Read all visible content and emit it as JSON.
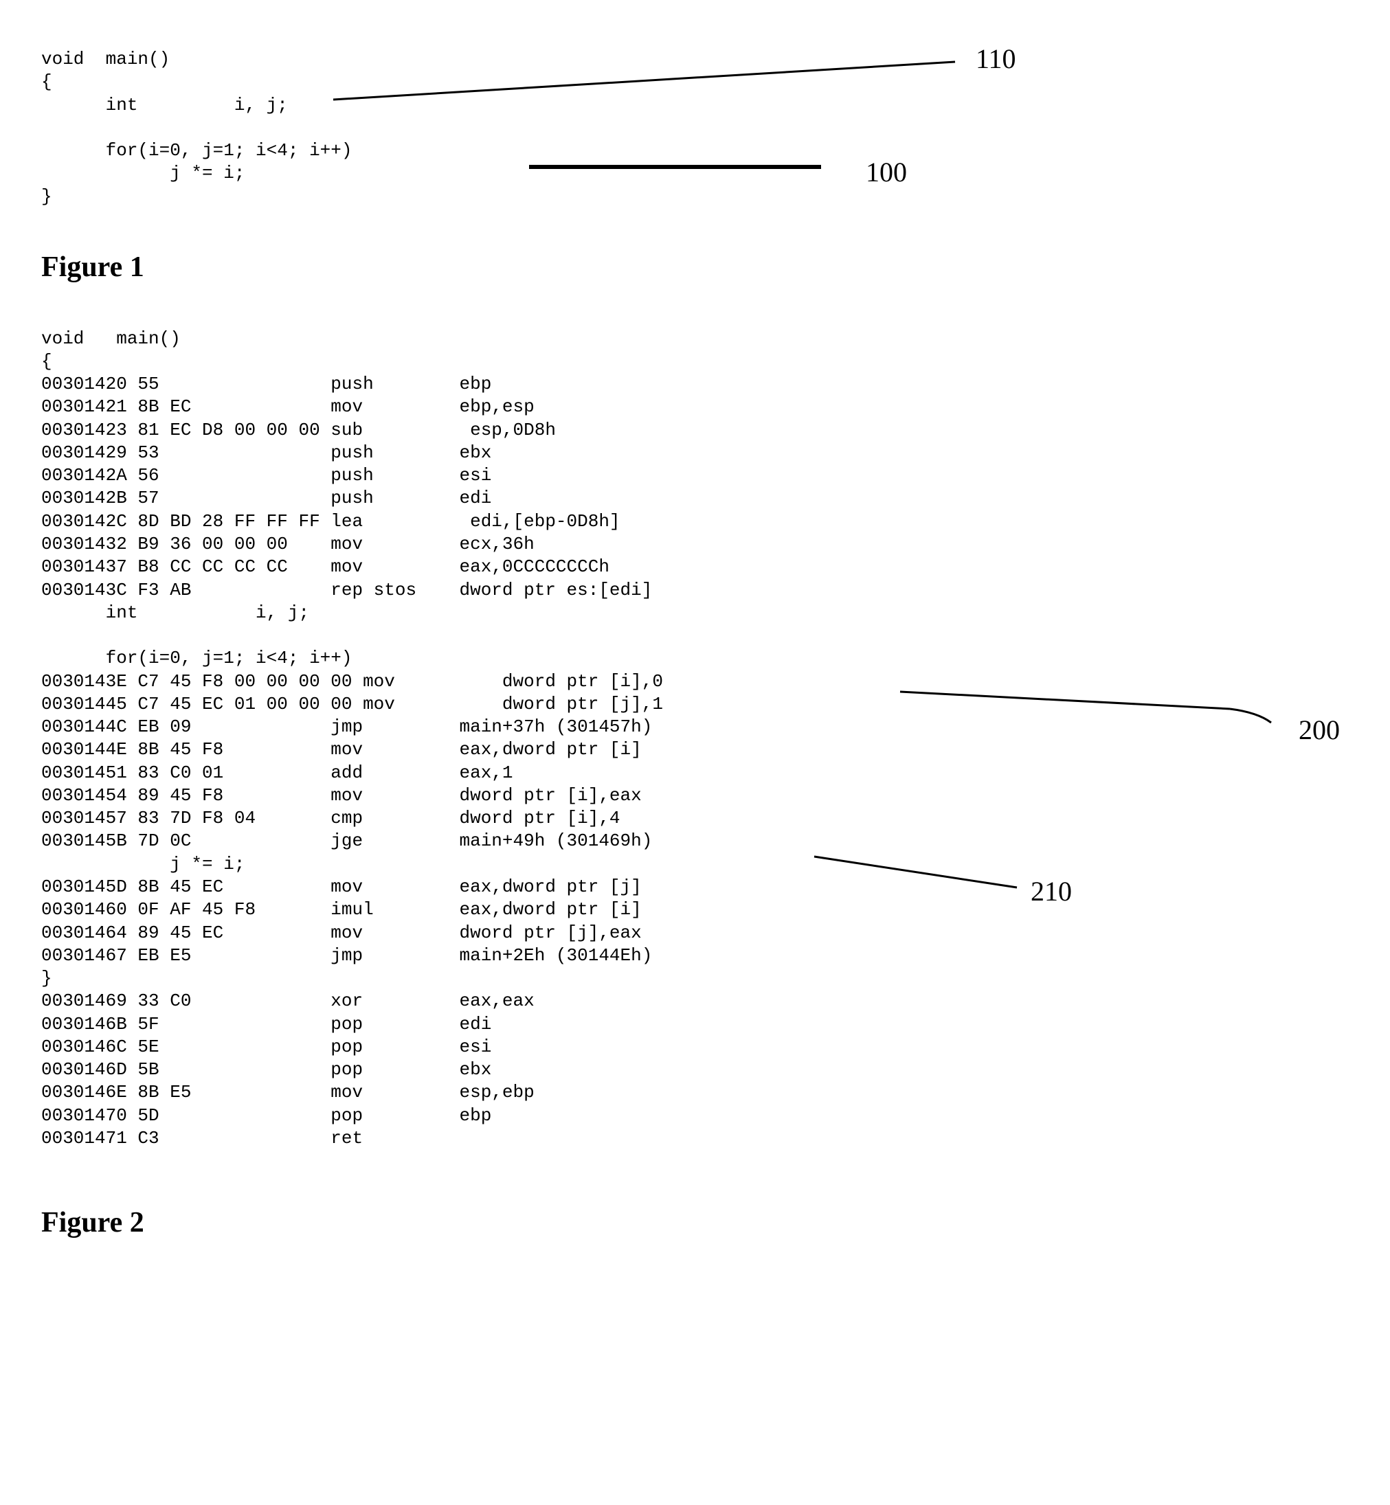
{
  "figure1": {
    "code_lines": [
      "void  main()",
      "{",
      "      int         i, j;",
      "",
      "      for(i=0, j=1; i<4; i++)",
      "            j *= i;",
      "}"
    ],
    "label": "Figure 1",
    "callouts": {
      "top": "110",
      "bottom": "100"
    }
  },
  "figure2": {
    "code_lines": [
      "void   main()",
      "{",
      "00301420 55                push        ebp",
      "00301421 8B EC             mov         ebp,esp",
      "00301423 81 EC D8 00 00 00 sub          esp,0D8h",
      "00301429 53                push        ebx",
      "0030142A 56                push        esi",
      "0030142B 57                push        edi",
      "0030142C 8D BD 28 FF FF FF lea          edi,[ebp-0D8h]",
      "00301432 B9 36 00 00 00    mov         ecx,36h",
      "00301437 B8 CC CC CC CC    mov         eax,0CCCCCCCCh",
      "0030143C F3 AB             rep stos    dword ptr es:[edi]",
      "      int           i, j;",
      "",
      "      for(i=0, j=1; i<4; i++)",
      "0030143E C7 45 F8 00 00 00 00 mov          dword ptr [i],0",
      "00301445 C7 45 EC 01 00 00 00 mov          dword ptr [j],1",
      "0030144C EB 09             jmp         main+37h (301457h)",
      "0030144E 8B 45 F8          mov         eax,dword ptr [i]",
      "00301451 83 C0 01          add         eax,1",
      "00301454 89 45 F8          mov         dword ptr [i],eax",
      "00301457 83 7D F8 04       cmp         dword ptr [i],4",
      "0030145B 7D 0C             jge         main+49h (301469h)",
      "            j *= i;",
      "0030145D 8B 45 EC          mov         eax,dword ptr [j]",
      "00301460 0F AF 45 F8       imul        eax,dword ptr [i]",
      "00301464 89 45 EC          mov         dword ptr [j],eax",
      "00301467 EB E5             jmp         main+2Eh (30144Eh)",
      "}",
      "00301469 33 C0             xor         eax,eax",
      "0030146B 5F                pop         edi",
      "0030146C 5E                pop         esi",
      "0030146D 5B                pop         ebx",
      "0030146E 8B E5             mov         esp,ebp",
      "00301470 5D                pop         ebp",
      "00301471 C3                ret"
    ],
    "label": "Figure 2",
    "callouts": {
      "right_top": "200",
      "right_bottom": "210"
    }
  }
}
